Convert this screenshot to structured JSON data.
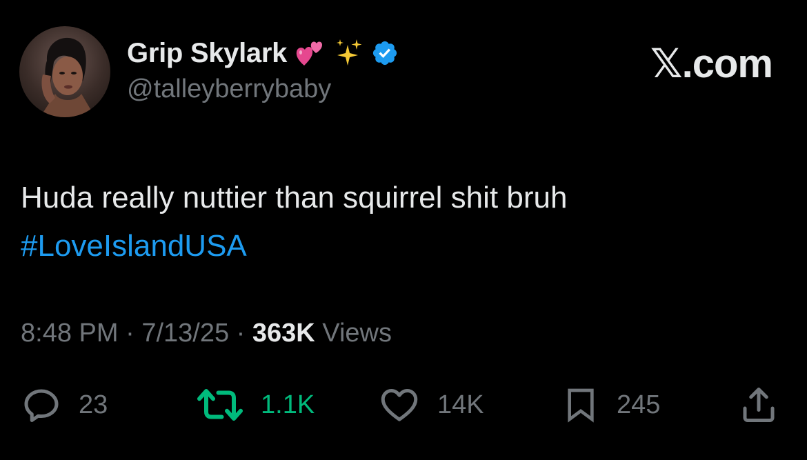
{
  "author": {
    "display_name": "Grip Skylark",
    "handle": "@talleyberrybaby",
    "name_emojis": [
      "two-hearts",
      "sparkles"
    ],
    "verified": true
  },
  "brand": "𝕏.com",
  "tweet": {
    "text": "Huda really nuttier than squirrel shit bruh",
    "hashtag": "#LoveIslandUSA"
  },
  "meta": {
    "time": "8:48 PM",
    "date": "7/13/25",
    "separator": "·",
    "views_count": "363K",
    "views_label": "Views"
  },
  "actions": {
    "replies": "23",
    "retweets": "1.1K",
    "likes": "14K",
    "bookmarks": "245"
  },
  "colors": {
    "background": "#000000",
    "primary_text": "#e7e9ea",
    "secondary_text": "#71767b",
    "link": "#1d9bf0",
    "retweet": "#00ba7c",
    "verified": "#1d9bf0"
  },
  "icons": [
    "reply-icon",
    "retweet-icon",
    "like-icon",
    "bookmark-icon",
    "share-icon",
    "verified-badge-icon"
  ]
}
